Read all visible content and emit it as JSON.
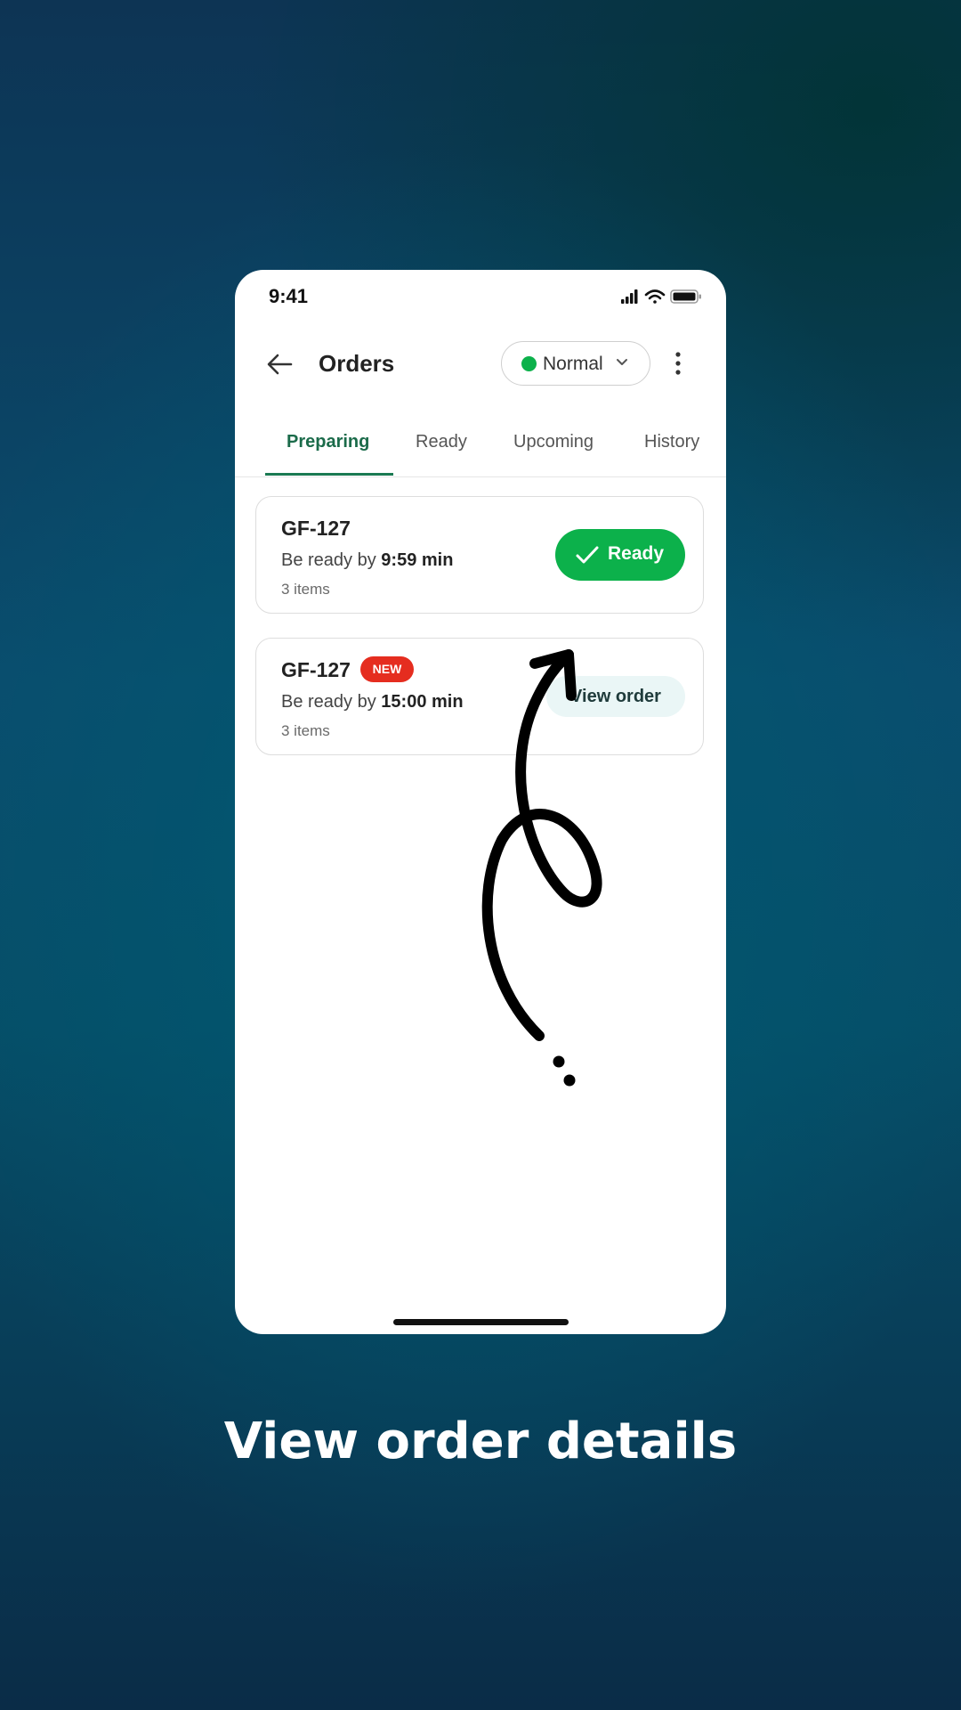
{
  "status_bar": {
    "time": "9:41",
    "icons": [
      "signal-icon",
      "wifi-icon",
      "battery-icon"
    ]
  },
  "header": {
    "back_icon": "arrow-left-icon",
    "title": "Orders",
    "mode": {
      "label": "Normal",
      "status_color": "#0cb14b",
      "icon": "chevron-down-icon"
    },
    "more_icon": "more-vertical-icon"
  },
  "tabs": [
    {
      "label": "Preparing",
      "active": true
    },
    {
      "label": "Ready",
      "active": false
    },
    {
      "label": "Upcoming",
      "active": false
    },
    {
      "label": "History",
      "active": false
    }
  ],
  "orders": [
    {
      "id": "GF-127",
      "badge": "",
      "eta_prefix": "Be ready by ",
      "eta_value": "9:59 min",
      "items": "3 items",
      "action_label": "Ready",
      "action_icon": "check-icon"
    },
    {
      "id": "GF-127",
      "badge": "NEW",
      "eta_prefix": "Be ready by ",
      "eta_value": "15:00 min",
      "items": "3 items",
      "action_label": "View order"
    }
  ],
  "colors": {
    "accent_green": "#0cb14b",
    "tab_active": "#1b6b4a",
    "badge_red": "#e52d1f",
    "view_button_bg": "#eaf6f6"
  },
  "caption": "View order details"
}
